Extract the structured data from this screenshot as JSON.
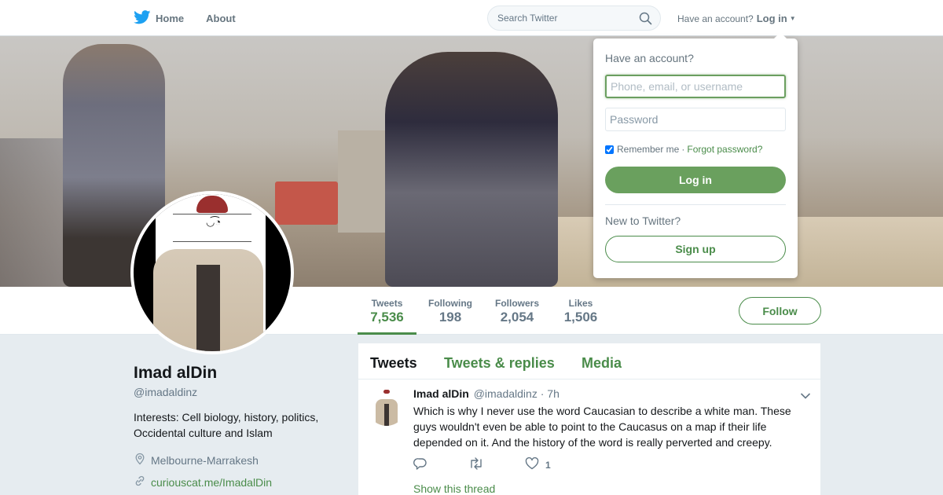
{
  "colors": {
    "accent": "#4a8c4a",
    "login_button": "#6aa05e",
    "twitter_blue": "#1da1f2"
  },
  "nav": {
    "home_label": "Home",
    "about_label": "About",
    "search_placeholder": "Search Twitter",
    "have_account": "Have an account?",
    "login_label": "Log in",
    "icons": [
      "twitter-bird-icon",
      "search-icon",
      "caret-down-icon"
    ]
  },
  "login_dropdown": {
    "title": "Have an account?",
    "username_placeholder": "Phone, email, or username",
    "password_placeholder": "Password",
    "remember_label": "Remember me",
    "separator": "·",
    "forgot_label": "Forgot password?",
    "remember_checked": true,
    "login_button": "Log in",
    "new_prompt": "New to Twitter?",
    "signup_button": "Sign up"
  },
  "stats": [
    {
      "label": "Tweets",
      "value": "7,536",
      "active": true
    },
    {
      "label": "Following",
      "value": "198",
      "active": false
    },
    {
      "label": "Followers",
      "value": "2,054",
      "active": false
    },
    {
      "label": "Likes",
      "value": "1,506",
      "active": false
    }
  ],
  "follow_button": "Follow",
  "profile": {
    "name": "Imad alDin",
    "handle": "@imadaldinz",
    "bio": "Interests: Cell biology, history, politics, Occidental culture and Islam",
    "location": "Melbourne-Marrakesh",
    "url": "curiouscat.me/ImadalDin"
  },
  "timeline": {
    "tabs": [
      "Tweets",
      "Tweets & replies",
      "Media"
    ],
    "tweet": {
      "name": "Imad alDin",
      "handle": "@imadaldinz",
      "dot": "·",
      "time": "7h",
      "text": "Which is why I never use the word Caucasian to describe a white man. These guys wouldn't even be able to point to the Caucasus on a map if their life depended on it. And the history of the word is really perverted and creepy.",
      "like_count": "1",
      "show_thread": "Show this thread"
    }
  }
}
